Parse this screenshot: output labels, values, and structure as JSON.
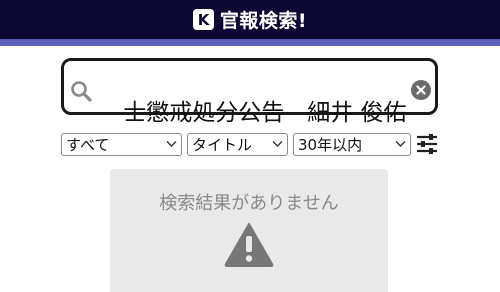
{
  "header": {
    "logo_letter": "K",
    "title": "官報検索!",
    "background_color": "#0c0733",
    "accent_color": "#5d5fbf"
  },
  "search": {
    "value": "士懲戒処分公告　細井 俊佑",
    "icon": "search-icon",
    "clear_icon": "clear-icon"
  },
  "filters": {
    "category": "すべて",
    "field": "タイトル",
    "period": "30年以内",
    "settings_icon": "sliders-icon"
  },
  "results": {
    "empty_message": "検索結果がありません",
    "icon": "warning-icon"
  }
}
